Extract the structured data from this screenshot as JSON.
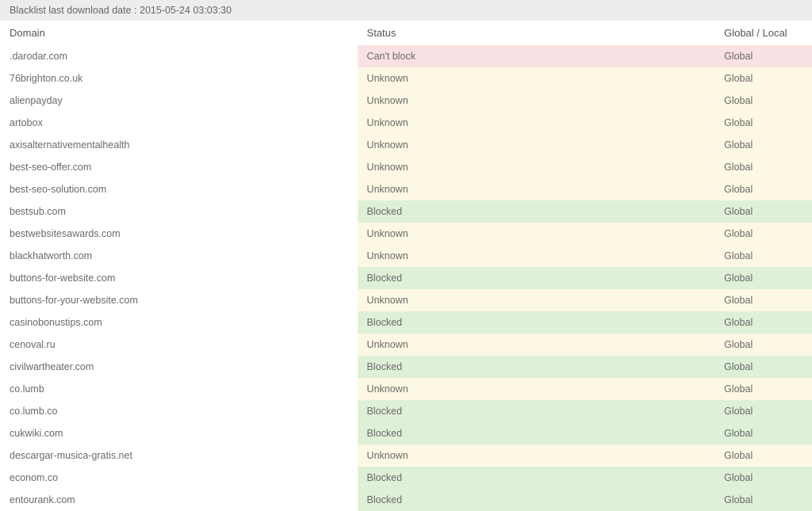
{
  "header": {
    "blacklist_label": "Blacklist last download date :",
    "blacklist_date": "2015-05-24 03:03:30"
  },
  "table": {
    "columns": {
      "domain": "Domain",
      "status": "Status",
      "scope": "Global / Local"
    },
    "rows": [
      {
        "domain": ".darodar.com",
        "status": "Can't block",
        "status_class": "status-cantblock",
        "scope": "Global"
      },
      {
        "domain": "76brighton.co.uk",
        "status": "Unknown",
        "status_class": "status-unknown",
        "scope": "Global"
      },
      {
        "domain": "alienpayday",
        "status": "Unknown",
        "status_class": "status-unknown",
        "scope": "Global"
      },
      {
        "domain": "artobox",
        "status": "Unknown",
        "status_class": "status-unknown",
        "scope": "Global"
      },
      {
        "domain": "axisalternativementalhealth",
        "status": "Unknown",
        "status_class": "status-unknown",
        "scope": "Global"
      },
      {
        "domain": "best-seo-offer.com",
        "status": "Unknown",
        "status_class": "status-unknown",
        "scope": "Global"
      },
      {
        "domain": "best-seo-solution.com",
        "status": "Unknown",
        "status_class": "status-unknown",
        "scope": "Global"
      },
      {
        "domain": "bestsub.com",
        "status": "Blocked",
        "status_class": "status-blocked",
        "scope": "Global"
      },
      {
        "domain": "bestwebsitesawards.com",
        "status": "Unknown",
        "status_class": "status-unknown",
        "scope": "Global"
      },
      {
        "domain": "blackhatworth.com",
        "status": "Unknown",
        "status_class": "status-unknown",
        "scope": "Global"
      },
      {
        "domain": "buttons-for-website.com",
        "status": "Blocked",
        "status_class": "status-blocked",
        "scope": "Global"
      },
      {
        "domain": "buttons-for-your-website.com",
        "status": "Unknown",
        "status_class": "status-unknown",
        "scope": "Global"
      },
      {
        "domain": "casinobonustips.com",
        "status": "Blocked",
        "status_class": "status-blocked",
        "scope": "Global"
      },
      {
        "domain": "cenoval.ru",
        "status": "Unknown",
        "status_class": "status-unknown",
        "scope": "Global"
      },
      {
        "domain": "civilwartheater.com",
        "status": "Blocked",
        "status_class": "status-blocked",
        "scope": "Global"
      },
      {
        "domain": "co.lumb",
        "status": "Unknown",
        "status_class": "status-unknown",
        "scope": "Global"
      },
      {
        "domain": "co.lumb.co",
        "status": "Blocked",
        "status_class": "status-blocked",
        "scope": "Global"
      },
      {
        "domain": "cukwiki.com",
        "status": "Blocked",
        "status_class": "status-blocked",
        "scope": "Global"
      },
      {
        "domain": "descargar-musica-gratis.net",
        "status": "Unknown",
        "status_class": "status-unknown",
        "scope": "Global"
      },
      {
        "domain": "econom.co",
        "status": "Blocked",
        "status_class": "status-blocked",
        "scope": "Global"
      },
      {
        "domain": "entourank.com",
        "status": "Blocked",
        "status_class": "status-blocked",
        "scope": "Global"
      }
    ]
  }
}
